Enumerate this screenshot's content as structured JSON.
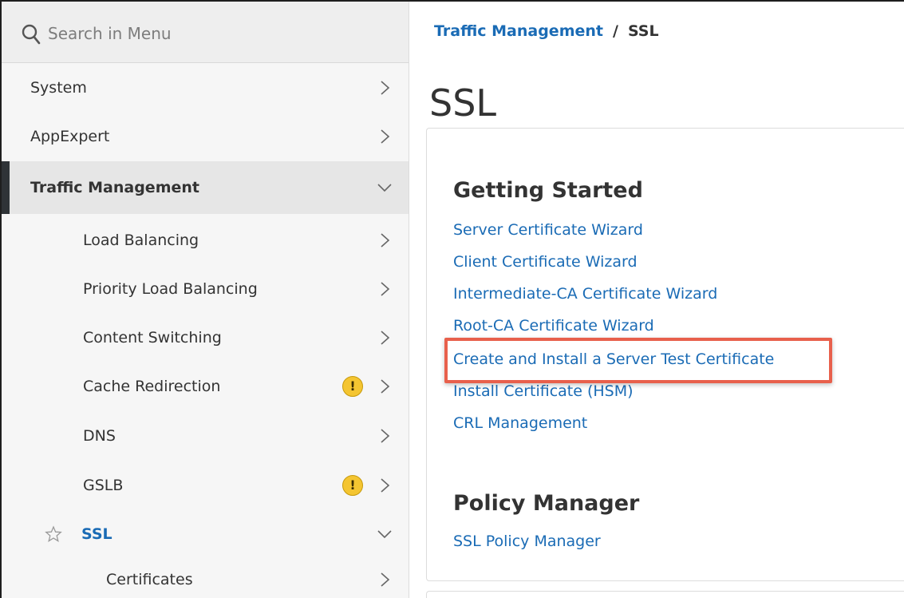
{
  "search": {
    "placeholder": "Search in Menu"
  },
  "sidebar": {
    "items": [
      {
        "label": "System"
      },
      {
        "label": "AppExpert"
      },
      {
        "label": "Traffic Management"
      },
      {
        "label": "Load Balancing"
      },
      {
        "label": "Priority Load Balancing"
      },
      {
        "label": "Content Switching"
      },
      {
        "label": "Cache Redirection",
        "warning": "!"
      },
      {
        "label": "DNS"
      },
      {
        "label": "GSLB",
        "warning": "!"
      },
      {
        "label": "SSL"
      },
      {
        "label": "Certificates"
      }
    ]
  },
  "breadcrumb": {
    "parent": "Traffic Management",
    "separator": "/",
    "current": "SSL"
  },
  "page_title": "SSL",
  "getting_started": {
    "title": "Getting Started",
    "links": [
      "Server Certificate Wizard",
      "Client Certificate Wizard",
      "Intermediate-CA Certificate Wizard",
      "Root-CA Certificate Wizard",
      "Create and Install a Server Test Certificate",
      "Install Certificate (HSM)",
      "CRL Management"
    ]
  },
  "policy_manager": {
    "title": "Policy Manager",
    "links": [
      "SSL Policy Manager"
    ]
  },
  "colors": {
    "link": "#1a6bb5",
    "highlight": "#e8604c",
    "warning": "#f4c531",
    "active_bar": "#2f3337"
  },
  "icons": {
    "search": "search-icon",
    "chevron_right": "chevron-right-icon",
    "chevron_down": "chevron-down-icon",
    "warning": "warning-icon",
    "star": "star-icon"
  }
}
